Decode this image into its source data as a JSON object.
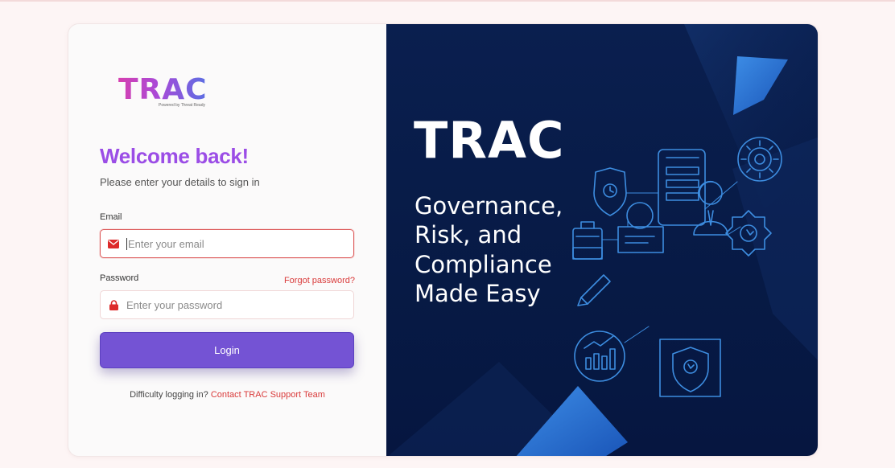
{
  "logo": {
    "text": "TRAC",
    "powered_by": "Powered by Threat Ready"
  },
  "form": {
    "heading": "Welcome back!",
    "subtitle": "Please enter your details to sign in",
    "email_label": "Email",
    "email_placeholder": "Enter your email",
    "password_label": "Password",
    "password_placeholder": "Enter your password",
    "forgot_link": "Forgot password?",
    "login_button": "Login",
    "help_text": "Difficulty logging in?",
    "help_link": "Contact TRAC Support Team"
  },
  "hero": {
    "title": "TRAC",
    "lines": [
      "Governance,",
      "Risk, and",
      "Compliance",
      "Made Easy"
    ]
  },
  "icons": {
    "email": "envelope-icon",
    "password": "lock-icon"
  },
  "colors": {
    "accent": "#9b4de6",
    "button": "#7453d4",
    "error": "#dd5a5a",
    "link": "#d93a3a",
    "hero_bg": "#0a1f4f",
    "illustration": "#3d8de0"
  }
}
